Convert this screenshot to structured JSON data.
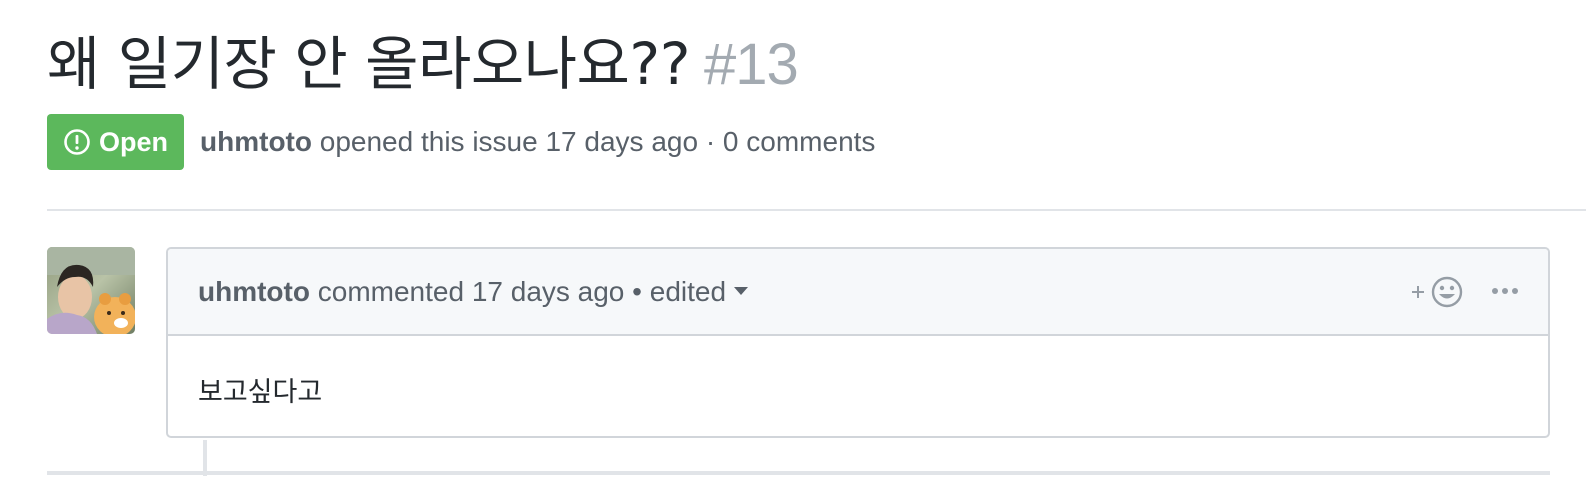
{
  "issue": {
    "title": "왜 일기장 안 올라오나요??",
    "number": "#13",
    "state": "Open",
    "state_color": "#5cb85c",
    "state_icon": "issue-opened-icon",
    "author": "uhmtoto",
    "opened_text": "opened this issue 17 days ago · 0 comments"
  },
  "comment": {
    "author": "uhmtoto",
    "meta_text": "commented 17 days ago • edited",
    "body": "보고싶다고",
    "reaction_icon": "add-reaction-icon",
    "more_icon": "kebab-horizontal-icon"
  },
  "colors": {
    "muted": "#586069",
    "number": "#a3aab1",
    "border": "#d1d5da",
    "header_bg": "#f6f8fa"
  }
}
